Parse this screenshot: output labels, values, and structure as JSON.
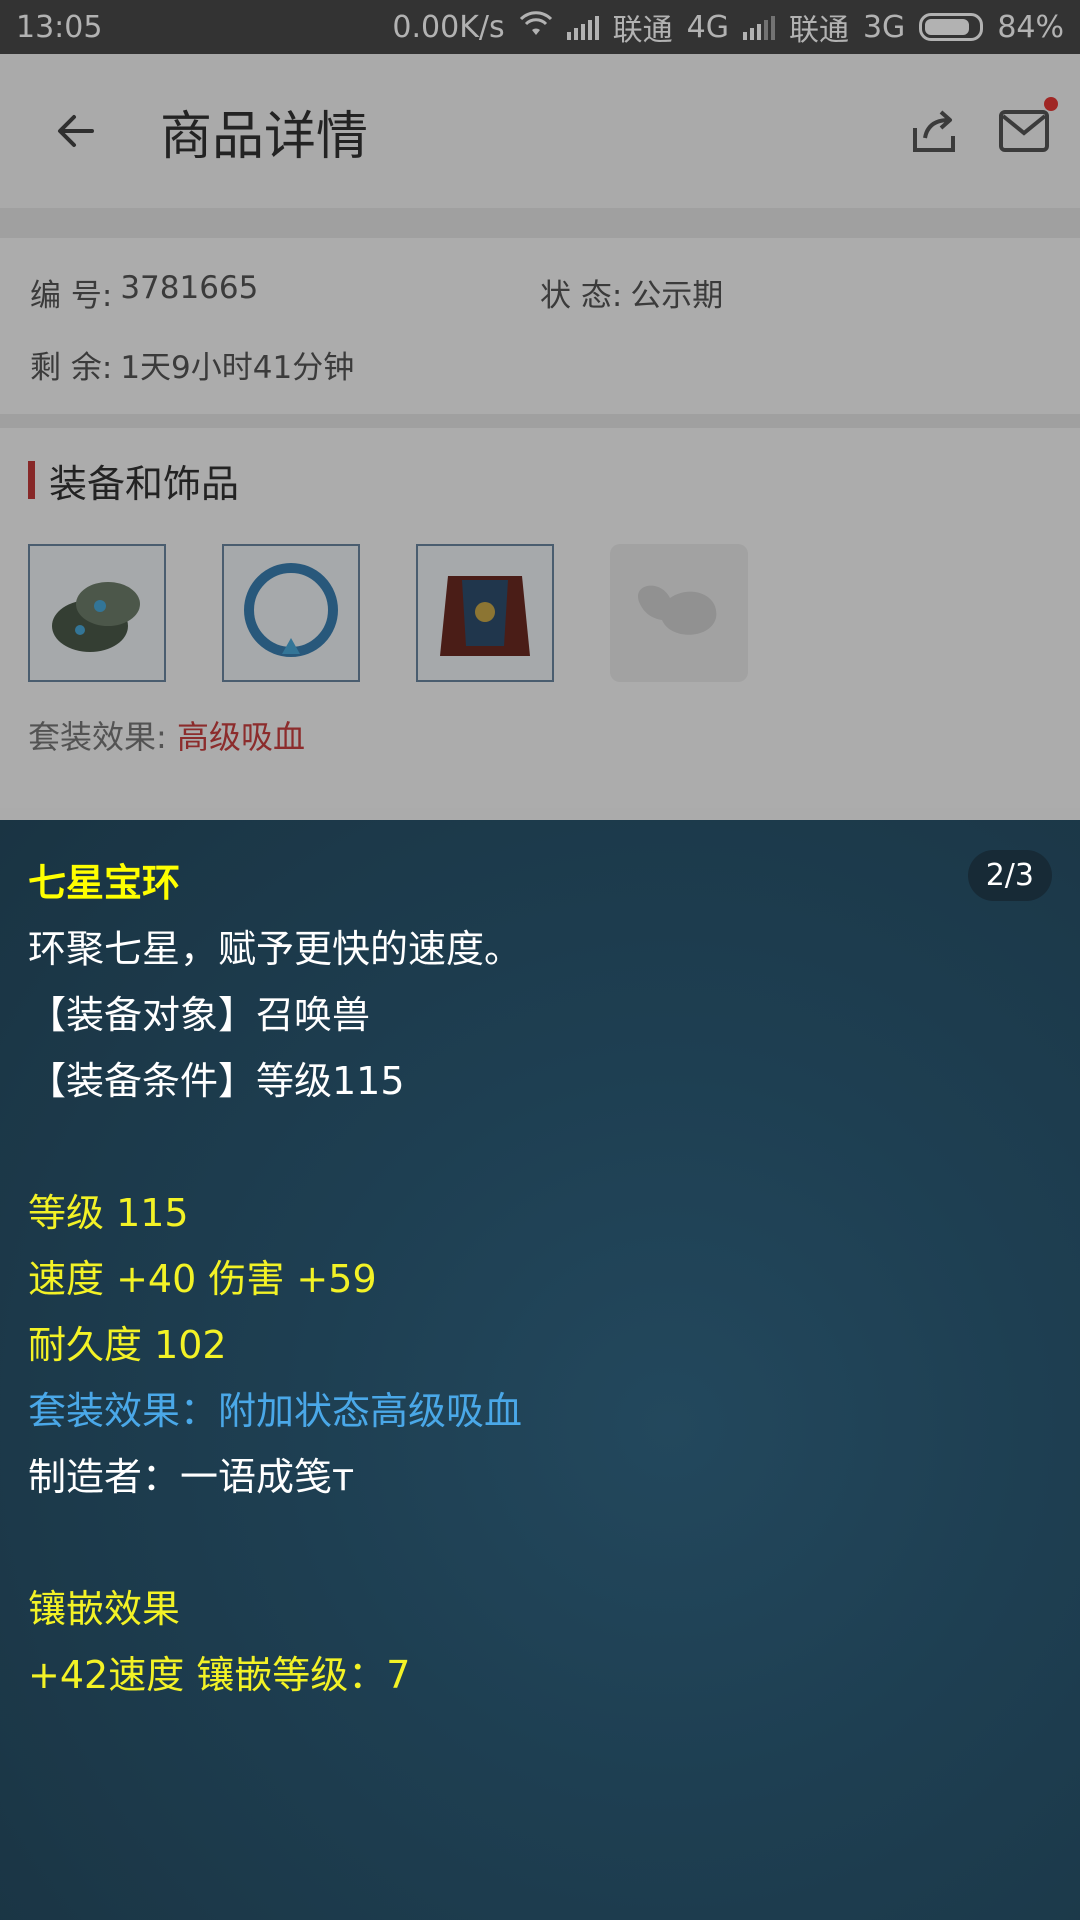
{
  "status_bar": {
    "time": "13:05",
    "speed": "0.00K/s",
    "carrier1": "联通",
    "net1": "4G",
    "carrier2": "联通",
    "net2": "3G",
    "battery": "84%",
    "battery_level": 0.84
  },
  "header": {
    "title": "商品详情",
    "icons": [
      "back-arrow-icon",
      "share-icon",
      "mail-icon"
    ]
  },
  "info": {
    "number_label": "编 号:",
    "number_value": "3781665",
    "status_label": "状 态:",
    "status_value": "公示期",
    "remaining_label": "剩 余:",
    "remaining_value": "1天9小时41分钟"
  },
  "equipment": {
    "title": "装备和饰品",
    "items": [
      "armguard-item",
      "ring-item",
      "armor-item",
      "empty-slot"
    ],
    "set_label": "套装效果:",
    "set_value": "高级吸血"
  },
  "tooltip": {
    "pager": "2/3",
    "name": "七星宝环",
    "desc": "环聚七星，赋予更快的速度。",
    "target": "【装备对象】召唤兽",
    "condition": "【装备条件】等级115",
    "level": "等级 115",
    "stats": "速度 +40 伤害 +59",
    "durability": "耐久度 102",
    "set_effect": "套装效果：附加状态高级吸血",
    "maker": "制造者：一语成笺т",
    "inlay_title": "镶嵌效果",
    "inlay_value": "+42速度 镶嵌等级：7"
  }
}
